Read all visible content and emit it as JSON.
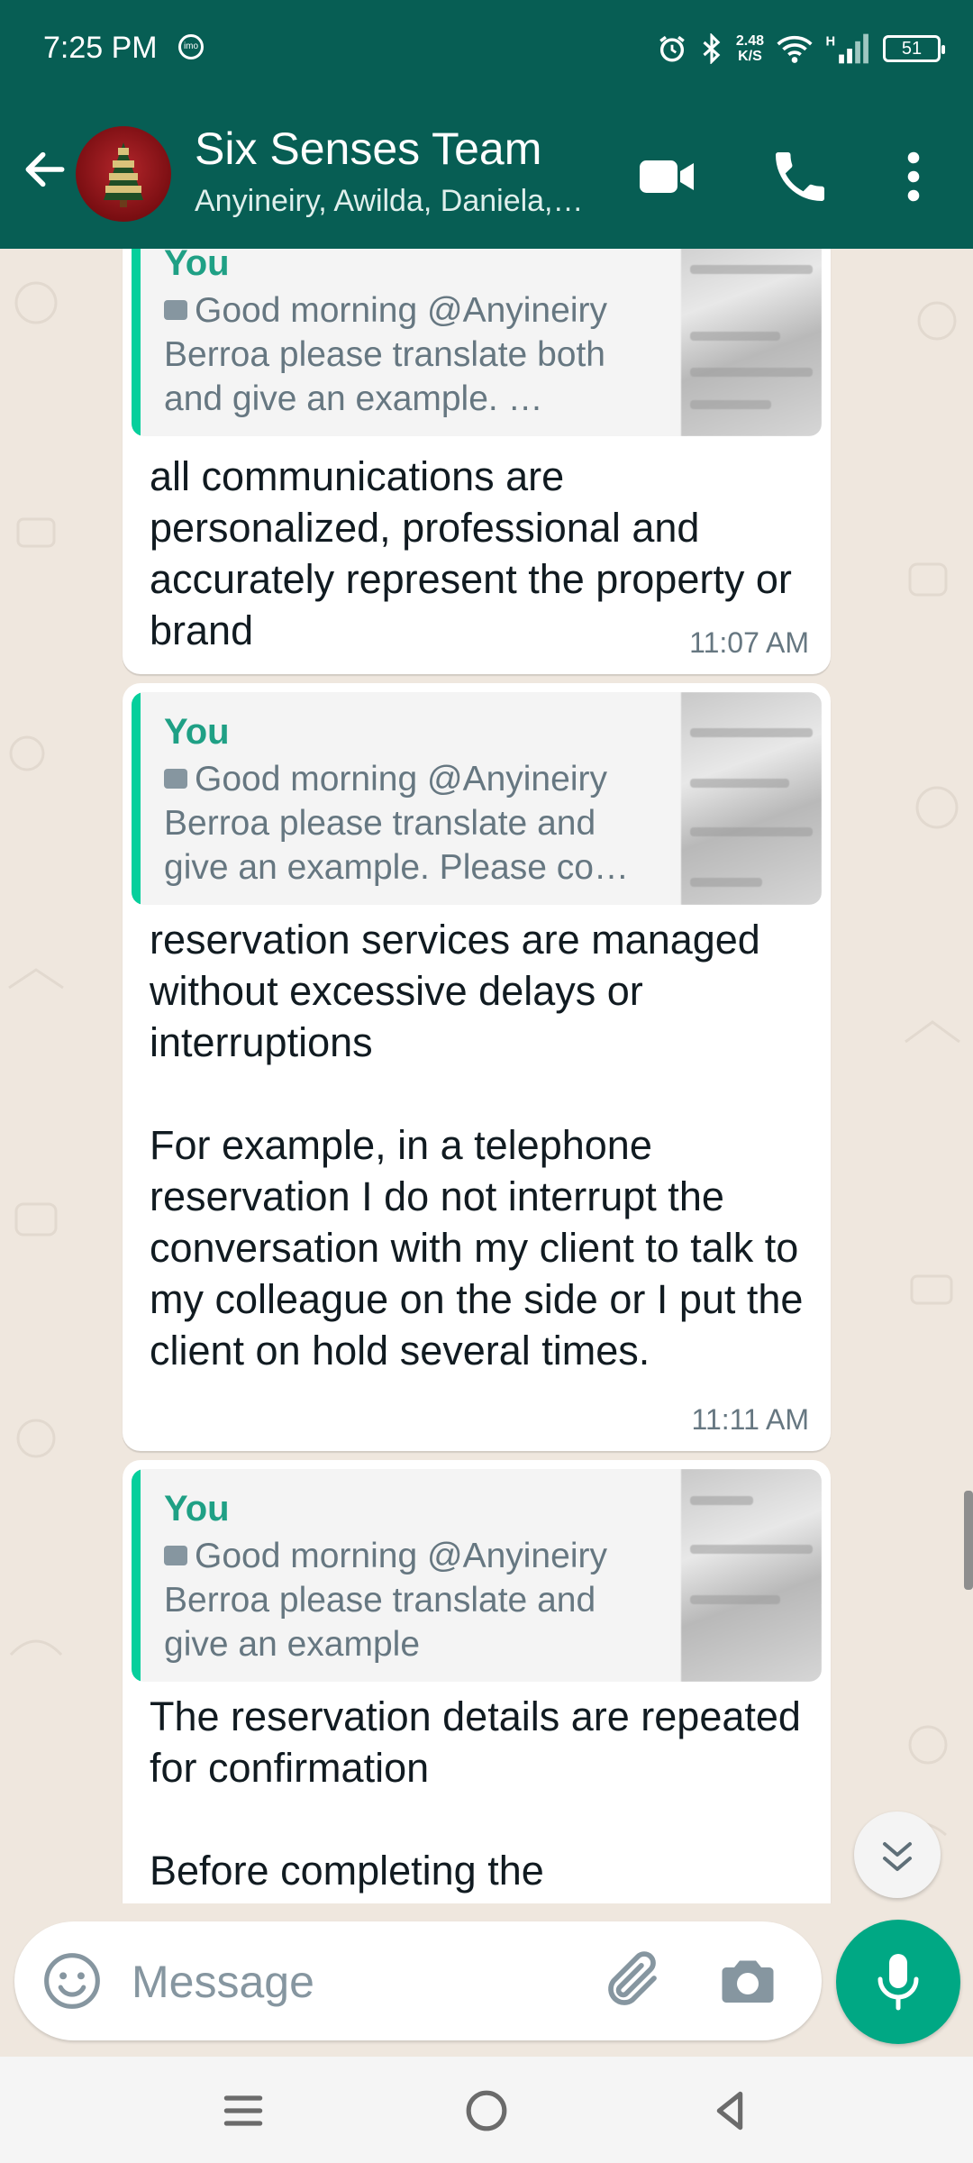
{
  "status_bar": {
    "time": "7:25 PM",
    "net_speed_value": "2.48",
    "net_speed_unit": "K/S",
    "battery": "51"
  },
  "chat_header": {
    "title": "Six Senses Team",
    "subtitle": "Anyineiry, Awilda, Daniela,…"
  },
  "messages": [
    {
      "quote_author": "You",
      "quote_text": "Good morning @Anyineiry Berroa please translate both and give an example. …",
      "text": "all communications are personalized, professional and accurately represent the property or brand",
      "time": "11:07 AM"
    },
    {
      "quote_author": "You",
      "quote_text": "Good morning @Anyineiry Berroa please translate and give an example. Please co…",
      "text": "reservation services are managed without excessive delays or interruptions\n\nFor example, in a telephone reservation I do not interrupt the conversation with my client to talk to my colleague on the side or I put the client on hold several times.",
      "time": "11:11 AM"
    },
    {
      "quote_author": "You",
      "quote_text": "Good morning @Anyineiry Berroa please translate and give an example",
      "text": "The reservation details are repeated for confirmation\n\nBefore completing the",
      "time": ""
    }
  ],
  "composer": {
    "placeholder": "Message"
  },
  "colors": {
    "header": "#075e54",
    "accent": "#00a884",
    "quote_bar": "#06cf9c",
    "chat_bg": "#efe7de"
  },
  "icons": [
    "back-arrow-icon",
    "video-call-icon",
    "voice-call-icon",
    "more-options-icon",
    "emoji-icon",
    "attach-icon",
    "camera-icon",
    "mic-icon",
    "scroll-down-icon",
    "recents-icon",
    "home-icon",
    "back-icon"
  ]
}
